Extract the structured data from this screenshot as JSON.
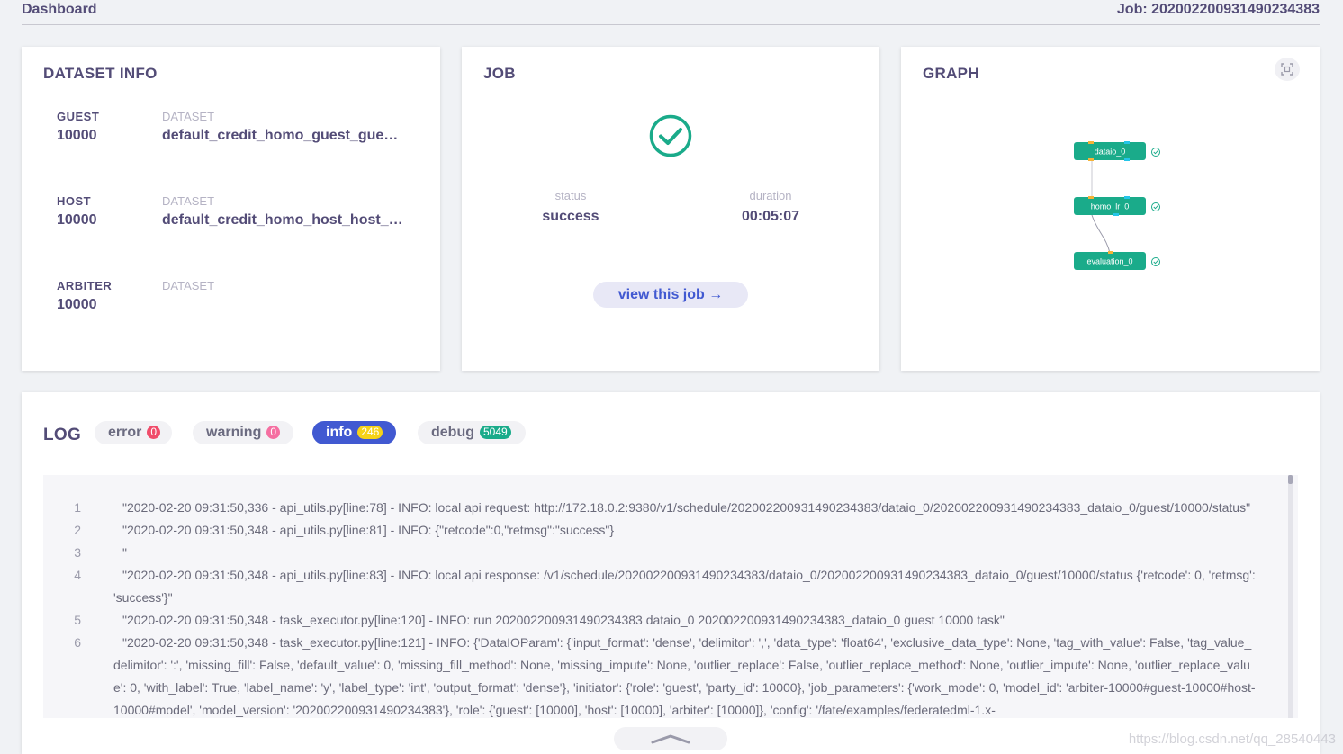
{
  "header": {
    "title": "Dashboard",
    "job_id": "Job: 20200220093149023438​3"
  },
  "dataset_info": {
    "title": "DATASET INFO",
    "roles": [
      {
        "role": "GUEST",
        "count": "10000",
        "dataset_label": "DATASET",
        "dataset": "default_credit_homo_guest_guest_data"
      },
      {
        "role": "HOST",
        "count": "10000",
        "dataset_label": "DATASET",
        "dataset": "default_credit_homo_host_host_data"
      },
      {
        "role": "ARBITER",
        "count": "10000",
        "dataset_label": "DATASET",
        "dataset": ""
      }
    ]
  },
  "job": {
    "title": "JOB",
    "status_label": "status",
    "status": "success",
    "duration_label": "duration",
    "duration": "00:05:07",
    "view_button": "view this job →",
    "status_color": "#1aab8a"
  },
  "graph": {
    "title": "GRAPH",
    "nodes": [
      {
        "label": "dataio_0",
        "status": "check-icon"
      },
      {
        "label": "homo_lr_0",
        "status": "check-icon"
      },
      {
        "label": "evaluation_0",
        "status": "check-icon"
      }
    ],
    "node_color": "#1aab8a"
  },
  "log": {
    "title": "LOG",
    "tabs": [
      {
        "label": "error",
        "count": "0",
        "badge_color": "#f04c6a"
      },
      {
        "label": "warning",
        "count": "0",
        "badge_color": "#f56fa1"
      },
      {
        "label": "info",
        "count": "246",
        "badge_color": "#f5d218",
        "active": true
      },
      {
        "label": "debug",
        "count": "5049",
        "badge_color": "#1aab8a"
      }
    ],
    "lines": [
      {
        "n": "1",
        "text": "\"2020-02-20 09:31:50,336 - api_utils.py[line:78] - INFO: local api request: http://172.18.0.2:9380/v1/schedule/202002200931490234383/dataio_0/202002200931490234383_dataio_0/guest/10000/status\""
      },
      {
        "n": "2",
        "text": "\"2020-02-20 09:31:50,348 - api_utils.py[line:81] - INFO: {\"retcode\":0,\"retmsg\":\"success\"}"
      },
      {
        "n": "3",
        "text": "\""
      },
      {
        "n": "4",
        "text": "\"2020-02-20 09:31:50,348 - api_utils.py[line:83] - INFO: local api response: /v1/schedule/202002200931490234383/dataio_0/202002200931490234383_dataio_0/guest/10000/status {'retcode': 0, 'retmsg': 'success'}\""
      },
      {
        "n": "5",
        "text": "\"2020-02-20 09:31:50,348 - task_executor.py[line:120] - INFO: run 202002200931490234383 dataio_0 202002200931490234383_dataio_0 guest 10000 task\""
      },
      {
        "n": "6",
        "text": "\"2020-02-20 09:31:50,348 - task_executor.py[line:121] - INFO: {'DataIOParam': {'input_format': 'dense', 'delimitor': ',', 'data_type': 'float64', 'exclusive_data_type': None, 'tag_with_value': False, 'tag_value_delimitor': ':', 'missing_fill': False, 'default_value': 0, 'missing_fill_method': None, 'missing_impute': None, 'outlier_replace': False, 'outlier_replace_method': None, 'outlier_impute': None, 'outlier_replace_value': 0, 'with_label': True, 'label_name': 'y', 'label_type': 'int', 'output_format': 'dense'}, 'initiator': {'role': 'guest', 'party_id': 10000}, 'job_parameters': {'work_mode': 0, 'model_id': 'arbiter-10000#guest-10000#host-10000#model', 'model_version': '202002200931490234383'}, 'role': {'guest': [10000], 'host': [10000], 'arbiter': [10000]}, 'config': '/fate/examples/federatedml-1.x-"
      }
    ]
  },
  "watermark": "https://blog.csdn.net/qq_28540443"
}
